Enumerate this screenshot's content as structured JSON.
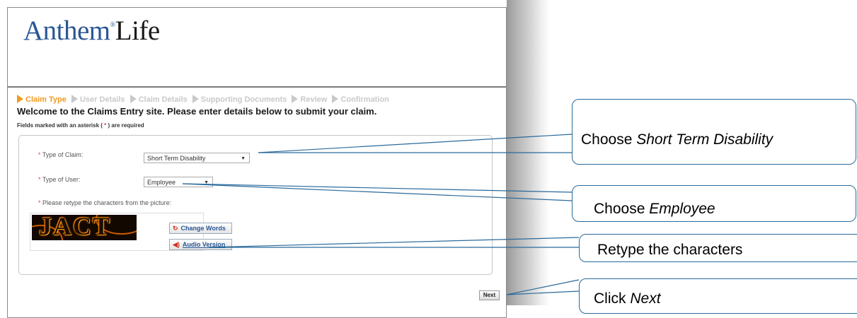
{
  "logo": {
    "part1": "Anthem",
    "reg": "®",
    "part2": "Life"
  },
  "steps": [
    "Claim Type",
    "User Details",
    "Claim Details",
    "Supporting Documents",
    "Review",
    "Confirmation"
  ],
  "welcome": "Welcome to the Claims Entry site. Please enter details below to submit your claim.",
  "required_note": {
    "prefix": "Fields marked with an asterisk (",
    "star": "*",
    "suffix": ") are required"
  },
  "form": {
    "claim_type_label": "Type of Claim:",
    "claim_type_value": "Short Term Disability",
    "user_type_label": "Type of User:",
    "user_type_value": "Employee",
    "captcha_label": "Please retype the characters from the picture:",
    "captcha_text": "JACT",
    "change_words": "Change Words",
    "audio_version": "Audio Version",
    "required_mark": "*",
    "dropdown_arrow": "▼"
  },
  "next_label": "Next",
  "callouts": {
    "claim": {
      "prefix": "Choose ",
      "em": "Short Term Disability"
    },
    "user": {
      "prefix": "Choose ",
      "em": "Employee"
    },
    "captcha": {
      "text": "Retype the characters"
    },
    "next": {
      "prefix": "Click ",
      "em": "Next"
    }
  },
  "colors": {
    "brand_blue": "#2a5696",
    "active_step": "#f39a20",
    "callout_border": "#2a6a9c",
    "required": "#e04040"
  },
  "icons": {
    "change_words": "refresh-icon",
    "audio": "speaker-icon",
    "step": "chevron-right-icon"
  }
}
